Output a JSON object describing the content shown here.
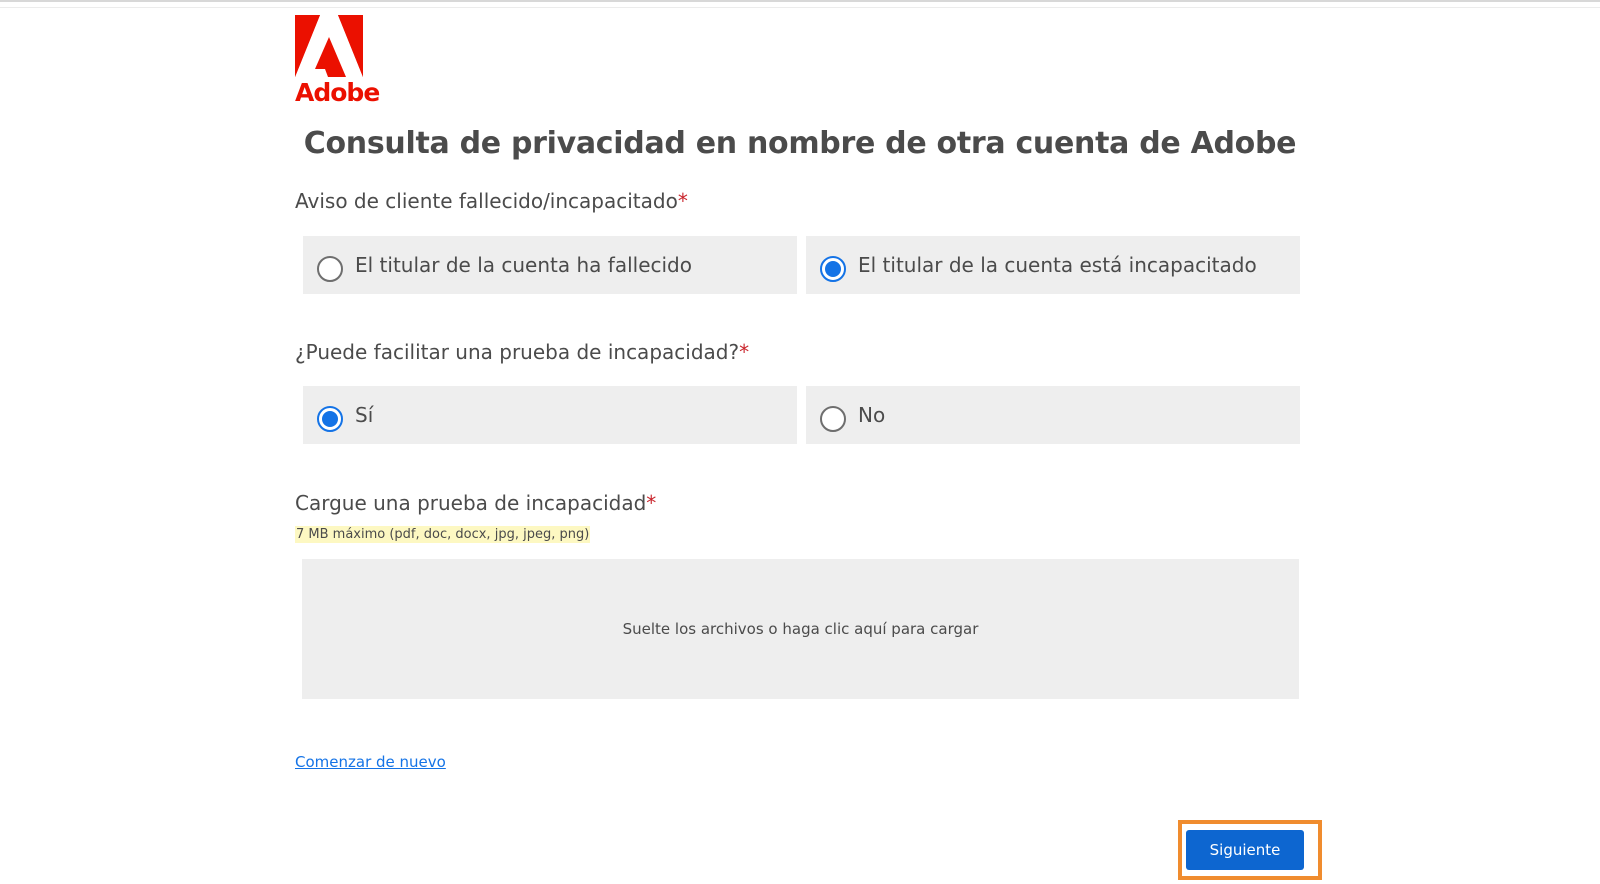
{
  "brand": {
    "logo_text": "Adobe",
    "color": "#EB1000"
  },
  "page": {
    "title": "Consulta de privacidad en nombre de otra cuenta de Adobe"
  },
  "questions": [
    {
      "label": "Aviso de cliente fallecido/incapacitado",
      "required_mark": "*",
      "options": [
        {
          "label": "El titular de la cuenta ha fallecido",
          "selected": false
        },
        {
          "label": "El titular de la cuenta está incapacitado",
          "selected": true
        }
      ]
    },
    {
      "label": "¿Puede facilitar una prueba de incapacidad?",
      "required_mark": "*",
      "options": [
        {
          "label": "Sí",
          "selected": true
        },
        {
          "label": "No",
          "selected": false
        }
      ]
    }
  ],
  "upload": {
    "label": "Cargue una prueba de incapacidad",
    "required_mark": "*",
    "hint": "7 MB máximo (pdf, doc, docx, jpg, jpeg, png)",
    "dropzone_text": "Suelte los archivos o haga clic aquí para cargar"
  },
  "actions": {
    "restart_label": "Comenzar de nuevo",
    "next_label": "Siguiente"
  },
  "colors": {
    "accent": "#1473E6",
    "button": "#0D66D0",
    "required": "#C9252C",
    "highlight": "#F08C2E",
    "option_bg": "#EEEEEE"
  }
}
